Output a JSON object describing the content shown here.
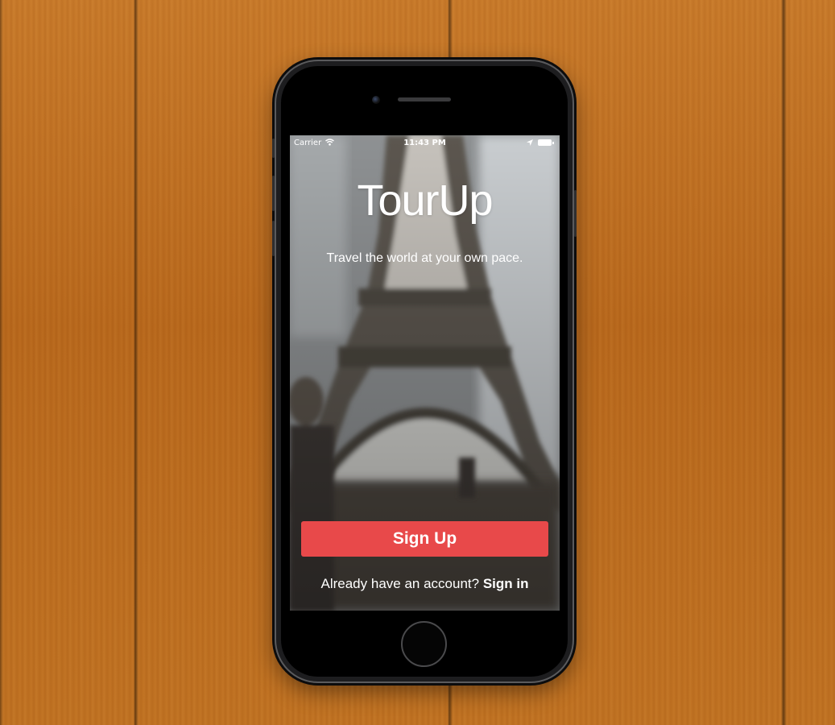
{
  "status_bar": {
    "carrier": "Carrier",
    "time": "11:43 PM"
  },
  "app": {
    "title": "TourUp",
    "tagline": "Travel the world at your own pace."
  },
  "actions": {
    "signup_label": "Sign Up",
    "signin_prompt": "Already have an account?",
    "signin_link": "Sign in"
  },
  "colors": {
    "accent": "#e8494a",
    "wood": "#c07222"
  },
  "icons": {
    "wifi": "wifi-icon",
    "location": "location-arrow-icon",
    "battery": "battery-icon",
    "camera": "front-camera-icon",
    "speaker": "earpiece-speaker-icon",
    "home": "home-button"
  }
}
